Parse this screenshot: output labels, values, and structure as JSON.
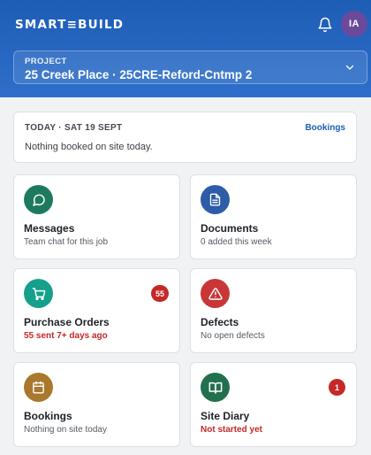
{
  "header": {
    "logo": "SMART≡BUILD",
    "user_initials": "IA",
    "project_label": "PROJECT",
    "project_name": "25 Creek Place · 25CRE-Reford-Cntmp 2"
  },
  "today": {
    "label": "TODAY · SAT 19 SEPT",
    "link": "Bookings",
    "message": "Nothing booked on site today."
  },
  "cards": [
    {
      "title": "Messages",
      "subtitle": "Team chat for this job",
      "icon": "chat-bubble-icon",
      "color": "#1e7a5e",
      "badge": null,
      "alert": false
    },
    {
      "title": "Documents",
      "subtitle": "0 added this week",
      "icon": "document-icon",
      "color": "#2d5ca8",
      "badge": null,
      "alert": false
    },
    {
      "title": "Purchase Orders",
      "subtitle": "55 sent 7+ days ago",
      "icon": "cart-icon",
      "color": "#14a08a",
      "badge": "55",
      "alert": true
    },
    {
      "title": "Defects",
      "subtitle": "No open defects",
      "icon": "warning-icon",
      "color": "#c83636",
      "badge": null,
      "alert": false
    },
    {
      "title": "Bookings",
      "subtitle": "Nothing on site today",
      "icon": "calendar-icon",
      "color": "#a9782c",
      "badge": null,
      "alert": false
    },
    {
      "title": "Site Diary",
      "subtitle": "Not started yet",
      "icon": "book-icon",
      "color": "#23704f",
      "badge": "1",
      "alert": true
    }
  ],
  "colors": {
    "header": "#2a68c2",
    "badge": "#c62828",
    "link": "#1e5fb4"
  }
}
